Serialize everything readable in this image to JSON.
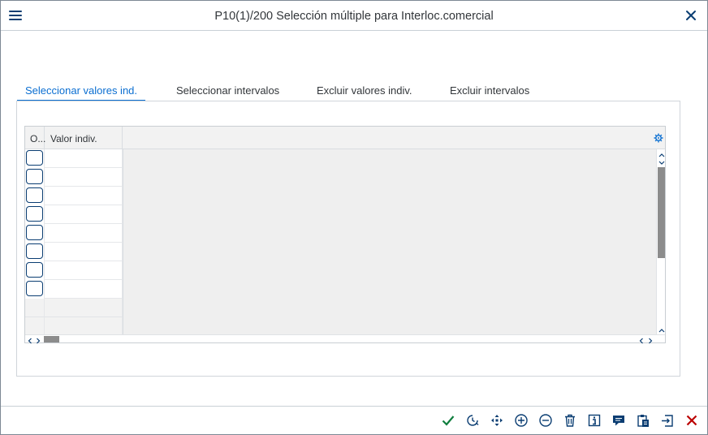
{
  "window": {
    "title": "P10(1)/200 Selección múltiple para Interloc.comercial"
  },
  "tabs": [
    {
      "label": "Seleccionar valores ind.",
      "active": true
    },
    {
      "label": "Seleccionar intervalos",
      "active": false
    },
    {
      "label": "Excluir valores indiv.",
      "active": false
    },
    {
      "label": "Excluir intervalos",
      "active": false
    }
  ],
  "table": {
    "columns": {
      "option": "O...",
      "value": "Valor indiv."
    },
    "rows": [
      "",
      "",
      "",
      "",
      "",
      "",
      "",
      ""
    ],
    "empty_rows": 2
  },
  "icons": {
    "menu": "hamburger-menu-icon",
    "close": "close-icon",
    "settings": "gear-icon",
    "footer": [
      "checkmark-icon",
      "history-icon",
      "move-icon",
      "add-circle-icon",
      "remove-circle-icon",
      "delete-icon",
      "info-icon",
      "comment-icon",
      "paste-icon",
      "upload-icon",
      "cancel-icon"
    ]
  },
  "colors": {
    "accent": "#0a6ed1",
    "icon_dark_blue": "#0a3d72",
    "confirm_green": "#107e3e",
    "cancel_red": "#bb0000"
  }
}
